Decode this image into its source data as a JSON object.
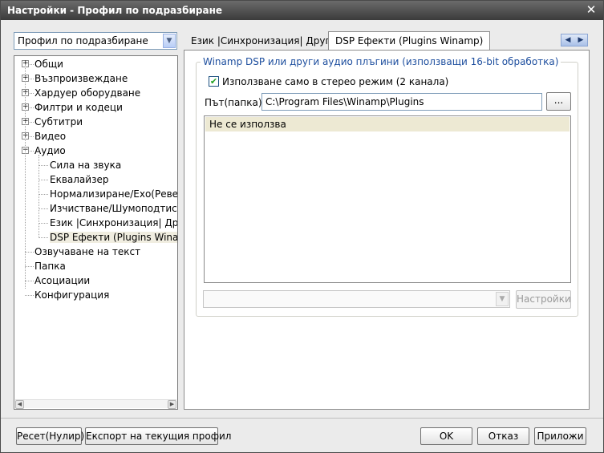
{
  "window": {
    "title": "Настройки - Профил по подразбиране",
    "close_glyph": "✕"
  },
  "profile_select": {
    "value": "Профил по подразбиране"
  },
  "tree": {
    "items": [
      {
        "label": "Общи",
        "expander": "+"
      },
      {
        "label": "Възпроизвеждане",
        "expander": "+"
      },
      {
        "label": "Хардуер оборудване",
        "expander": "+"
      },
      {
        "label": "Филтри и кодеци",
        "expander": "+"
      },
      {
        "label": "Субтитри",
        "expander": "+"
      },
      {
        "label": "Видео",
        "expander": "+"
      },
      {
        "label": "Аудио",
        "expander": "−"
      },
      {
        "label": "Сила на звука"
      },
      {
        "label": "Еквалайзер"
      },
      {
        "label": "Нормализиране/Ехо(Реверб"
      },
      {
        "label": "Изчистване/Шумоподтискан"
      },
      {
        "label": "Език |Синхронизация| Други"
      },
      {
        "label": "DSP Ефекти (Plugins Winamp",
        "selected": true
      },
      {
        "label": "Озвучаване на текст"
      },
      {
        "label": "Папка"
      },
      {
        "label": "Асоциации"
      },
      {
        "label": "Конфигурация"
      }
    ]
  },
  "tabs": [
    {
      "label": "Език |Синхронизация| Други",
      "active": false
    },
    {
      "label": "DSP Ефекти (Plugins Winamp)",
      "active": true
    }
  ],
  "dsp": {
    "group_title": "Winamp DSP или други аудио плъгини (използващи 16-bit обработка)",
    "stereo_checkbox": {
      "label": "Използване само в стерео режим (2 канала)",
      "checked": true
    },
    "path_label": "Път(папка):",
    "path_value": "C:\\Program Files\\Winamp\\Plugins",
    "browse_label": "...",
    "plugins": [
      "Не се използва"
    ],
    "plugin_select_value": "",
    "settings_label": "Настройки"
  },
  "footer": {
    "reset_label": "Ресет(Нулир)",
    "export_label": "Експорт на текущия профил",
    "ok_label": "OK",
    "cancel_label": "Отказ",
    "apply_label": "Приложи"
  },
  "colors": {
    "title_bar": "#4a4a4a",
    "group_title": "#1d4e9e",
    "check_mark": "#21a121"
  }
}
